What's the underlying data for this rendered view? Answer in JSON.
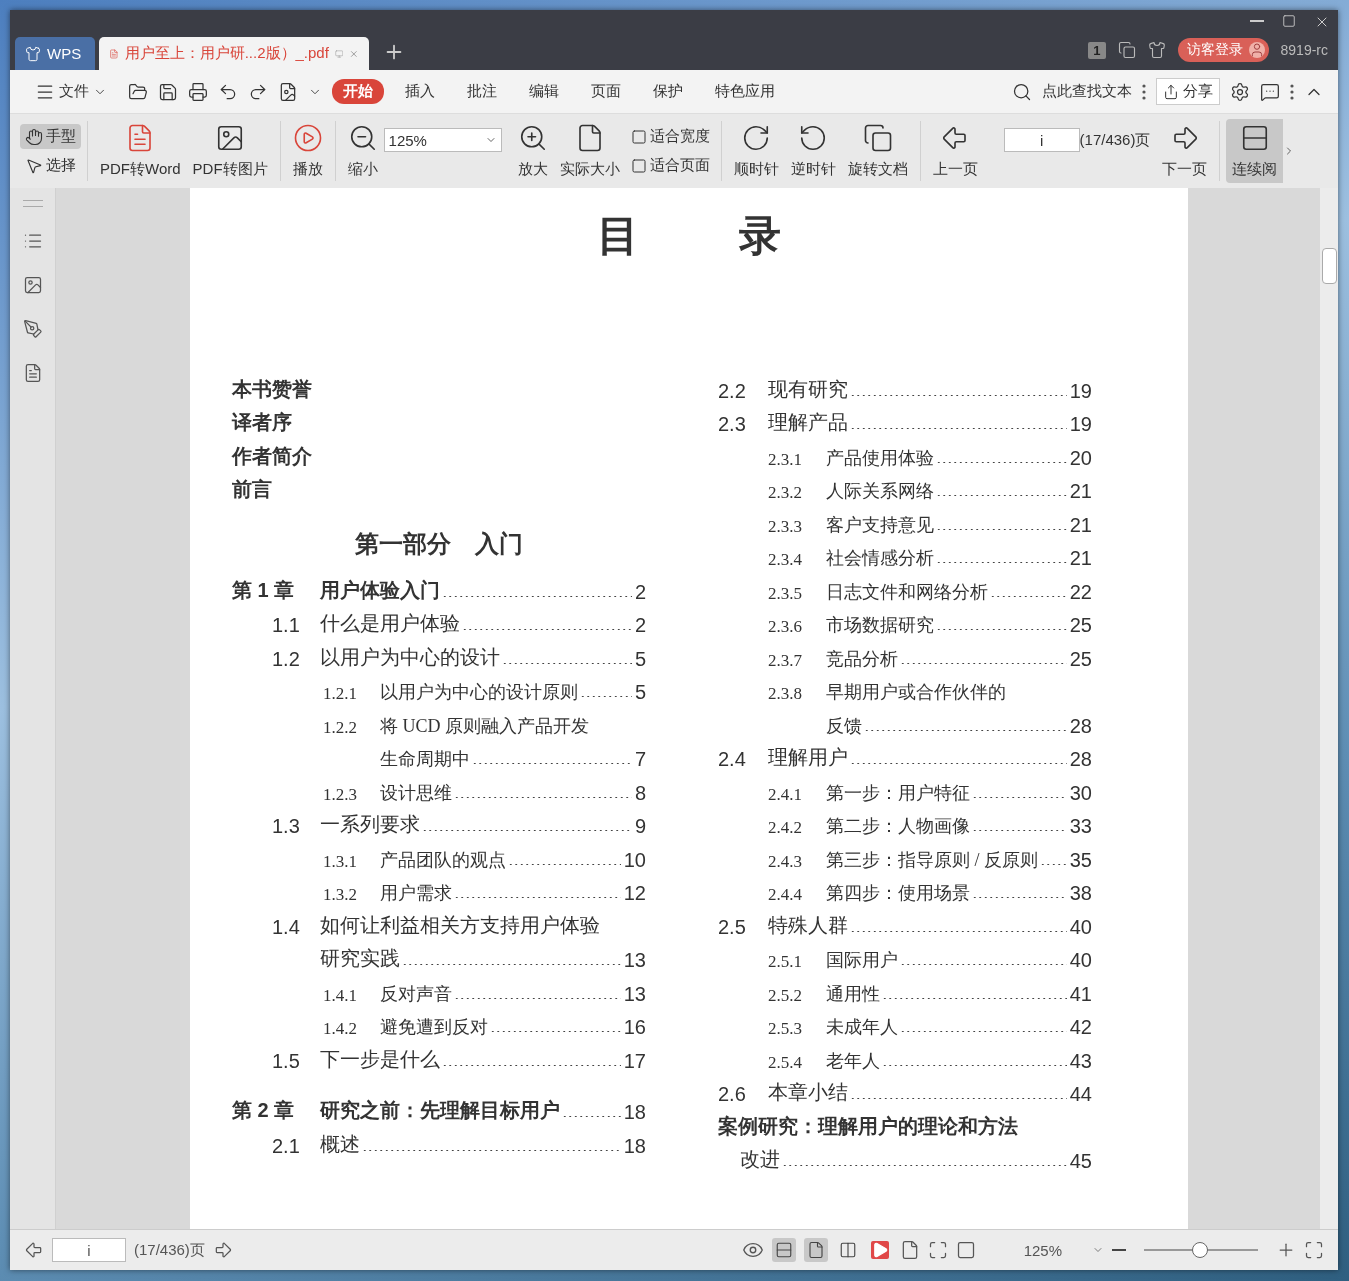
{
  "tabs": [
    {
      "label": "WPS",
      "kind": "home",
      "selected": false
    },
    {
      "label": "用户至上：用户研...2版）_.pdf",
      "kind": "document",
      "selected": true
    }
  ],
  "titlebar": {
    "badge": "1",
    "login": "访客登录",
    "user": "8919-rc"
  },
  "menu": {
    "file": "文件",
    "tabs": [
      {
        "label": "开始",
        "selected": true
      },
      {
        "label": "插入",
        "selected": false
      },
      {
        "label": "批注",
        "selected": false
      },
      {
        "label": "编辑",
        "selected": false
      },
      {
        "label": "页面",
        "selected": false
      },
      {
        "label": "保护",
        "selected": false
      },
      {
        "label": "特色应用",
        "selected": false
      }
    ],
    "search": "点此查找文本",
    "share": "分享"
  },
  "toolbar": {
    "hand": {
      "label": "手型",
      "selected": true
    },
    "select": {
      "label": "选择",
      "selected": false
    },
    "pdf_to_word": "PDF转Word",
    "pdf_to_image": "PDF转图片",
    "play": "播放",
    "zoom_out": "缩小",
    "zoom_value": "125%",
    "zoom_in": "放大",
    "actual_size": "实际大小",
    "fit_width": "适合宽度",
    "fit_page": "适合页面",
    "clockwise": "顺时针",
    "counterclockwise": "逆时针",
    "rotate_doc": "旋转文档",
    "prev_page": "上一页",
    "page_value": "i",
    "page_total": "(17/436)页",
    "next_page": "下一页",
    "continuous": {
      "label": "连续阅",
      "selected": true
    }
  },
  "toc": {
    "title": [
      "目",
      "录"
    ],
    "columns": [
      [
        {
          "kind": "front",
          "title": "本书赞誉"
        },
        {
          "kind": "front",
          "title": "译者序"
        },
        {
          "kind": "front",
          "title": "作者简介"
        },
        {
          "kind": "front",
          "title": "前言"
        },
        {
          "kind": "part",
          "title": "第一部分　入门"
        },
        {
          "kind": "chapter",
          "number": "第 1 章",
          "title": "用户体验入门",
          "page": "2"
        },
        {
          "kind": "section",
          "number": "1.1",
          "title": "什么是用户体验",
          "page": "2"
        },
        {
          "kind": "section",
          "number": "1.2",
          "title": "以用户为中心的设计",
          "page": "5"
        },
        {
          "kind": "subsection",
          "number": "1.2.1",
          "title": "以用户为中心的设计原则",
          "page": "5"
        },
        {
          "kind": "subsection",
          "number": "1.2.2",
          "title": "将 UCD 原则融入产品开发",
          "continuation": "生命周期中",
          "page": "7"
        },
        {
          "kind": "subsection",
          "number": "1.2.3",
          "title": "设计思维",
          "page": "8"
        },
        {
          "kind": "section",
          "number": "1.3",
          "title": "一系列要求",
          "page": "9"
        },
        {
          "kind": "subsection",
          "number": "1.3.1",
          "title": "产品团队的观点",
          "page": "10"
        },
        {
          "kind": "subsection",
          "number": "1.3.2",
          "title": "用户需求",
          "page": "12"
        },
        {
          "kind": "section",
          "number": "1.4",
          "title": "如何让利益相关方支持用户体验",
          "continuation": "研究实践",
          "page": "13"
        },
        {
          "kind": "subsection",
          "number": "1.4.1",
          "title": "反对声音",
          "page": "13"
        },
        {
          "kind": "subsection",
          "number": "1.4.2",
          "title": "避免遭到反对",
          "page": "16"
        },
        {
          "kind": "section",
          "number": "1.5",
          "title": "下一步是什么",
          "page": "17"
        },
        {
          "kind": "chapter",
          "number": "第 2 章",
          "title": "研究之前：先理解目标用户",
          "page": "18"
        },
        {
          "kind": "section",
          "number": "2.1",
          "title": "概述",
          "page": "18"
        }
      ],
      [
        {
          "kind": "section",
          "number": "2.2",
          "title": "现有研究",
          "page": "19"
        },
        {
          "kind": "section",
          "number": "2.3",
          "title": "理解产品",
          "page": "19"
        },
        {
          "kind": "subsection",
          "number": "2.3.1",
          "title": "产品使用体验",
          "page": "20"
        },
        {
          "kind": "subsection",
          "number": "2.3.2",
          "title": "人际关系网络",
          "page": "21"
        },
        {
          "kind": "subsection",
          "number": "2.3.3",
          "title": "客户支持意见",
          "page": "21"
        },
        {
          "kind": "subsection",
          "number": "2.3.4",
          "title": "社会情感分析",
          "page": "21"
        },
        {
          "kind": "subsection",
          "number": "2.3.5",
          "title": "日志文件和网络分析",
          "page": "22"
        },
        {
          "kind": "subsection",
          "number": "2.3.6",
          "title": "市场数据研究",
          "page": "25"
        },
        {
          "kind": "subsection",
          "number": "2.3.7",
          "title": "竞品分析",
          "page": "25"
        },
        {
          "kind": "subsection",
          "number": "2.3.8",
          "title": "早期用户或合作伙伴的",
          "continuation": "反馈",
          "page": "28"
        },
        {
          "kind": "section",
          "number": "2.4",
          "title": "理解用户",
          "page": "28"
        },
        {
          "kind": "subsection",
          "number": "2.4.1",
          "title": "第一步：用户特征",
          "page": "30"
        },
        {
          "kind": "subsection",
          "number": "2.4.2",
          "title": "第二步：人物画像",
          "page": "33"
        },
        {
          "kind": "subsection",
          "number": "2.4.3",
          "title": "第三步：指导原则 / 反原则",
          "page": "35"
        },
        {
          "kind": "subsection",
          "number": "2.4.4",
          "title": "第四步：使用场景",
          "page": "38"
        },
        {
          "kind": "section",
          "number": "2.5",
          "title": "特殊人群",
          "page": "40"
        },
        {
          "kind": "subsection",
          "number": "2.5.1",
          "title": "国际用户",
          "page": "40"
        },
        {
          "kind": "subsection",
          "number": "2.5.2",
          "title": "通用性",
          "page": "41"
        },
        {
          "kind": "subsection",
          "number": "2.5.3",
          "title": "未成年人",
          "page": "42"
        },
        {
          "kind": "subsection",
          "number": "2.5.4",
          "title": "老年人",
          "page": "43"
        },
        {
          "kind": "section",
          "number": "2.6",
          "title": "本章小结",
          "page": "44"
        },
        {
          "kind": "case",
          "title": "案例研究：理解用户的理论和方法",
          "continuation": "改进",
          "page": "45"
        }
      ]
    ]
  },
  "status": {
    "page_value": "i",
    "page_total": "(17/436)页",
    "view_modes": [
      {
        "selected": true
      },
      {
        "selected": true
      },
      {
        "selected": false
      }
    ],
    "zoom": "125%",
    "zoom_slider": {
      "level": 0.48
    }
  }
}
